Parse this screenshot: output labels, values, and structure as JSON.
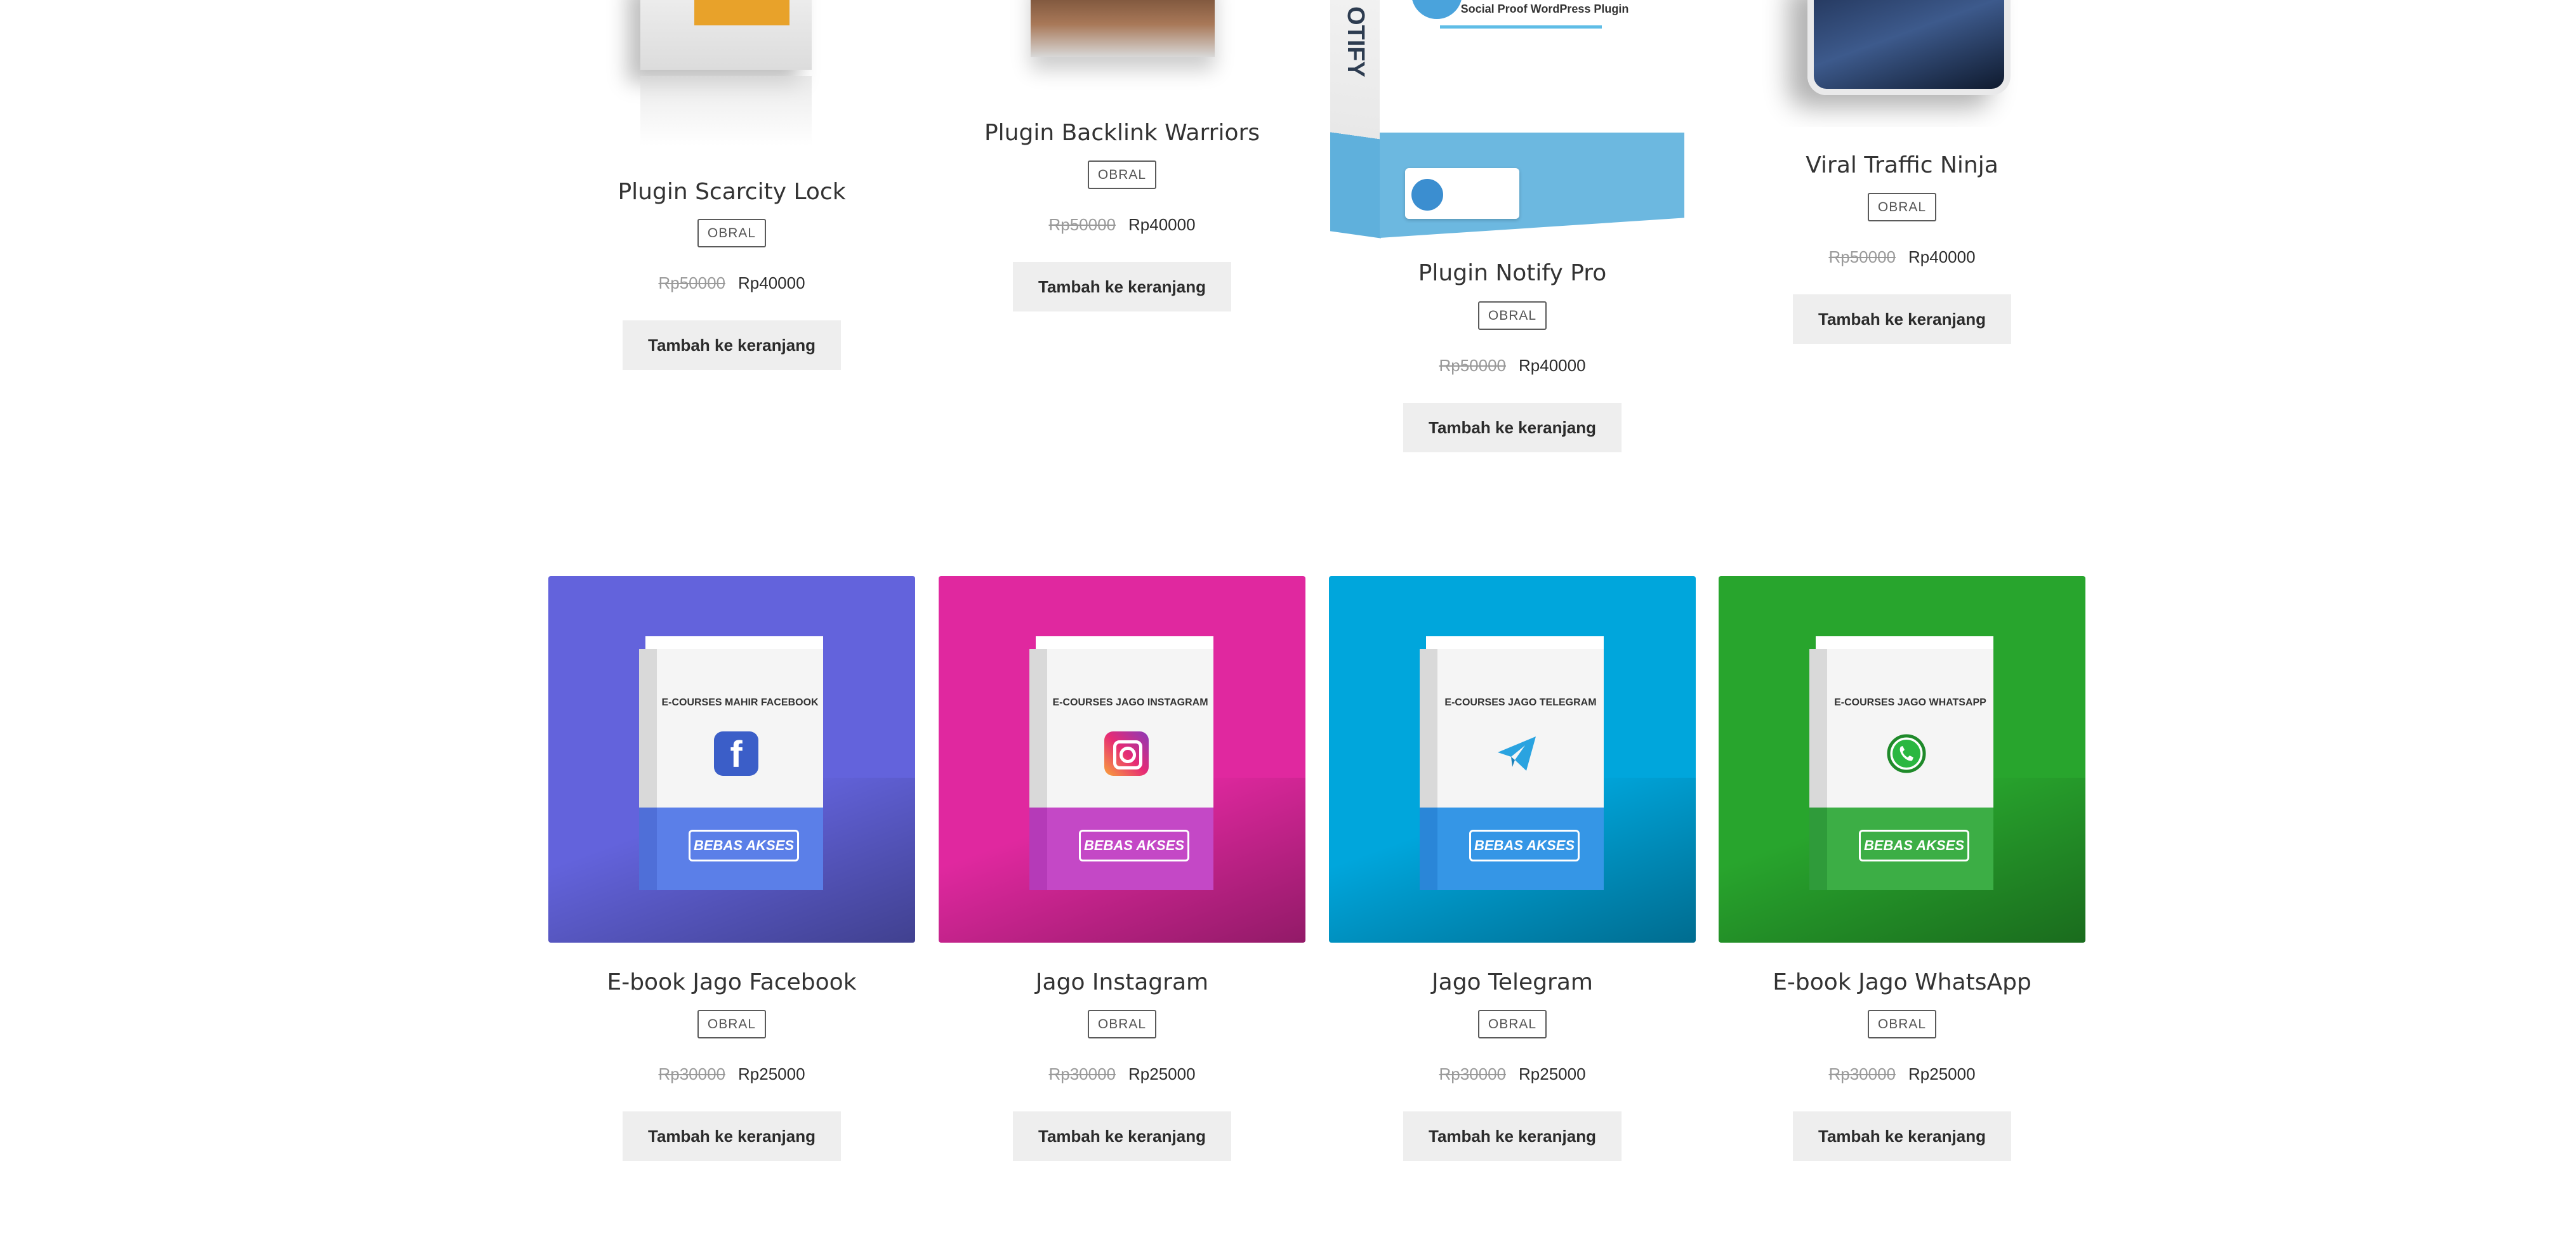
{
  "colors": {
    "page_bg": "#ffffff",
    "button_bg": "#eeeeee",
    "facebook_bg": "#6060d8",
    "instagram_bg": "#e0289f",
    "telegram_bg": "#00a6dc",
    "whatsapp_bg": "#28a52d"
  },
  "products_top": [
    {
      "title": "Plugin Scarcity Lock",
      "badge": "OBRAL",
      "price_old": "Rp50000",
      "price_new": "Rp40000",
      "button": "Tambah ke keranjang"
    },
    {
      "title": "Plugin Backlink Warriors",
      "badge": "OBRAL",
      "price_old": "Rp50000",
      "price_new": "Rp40000",
      "button": "Tambah ke keranjang"
    },
    {
      "title": "Plugin Notify Pro",
      "badge": "OBRAL",
      "price_old": "Rp50000",
      "price_new": "Rp40000",
      "button": "Tambah ke keranjang",
      "box_text": "Social Proof WordPress Plugin",
      "box_side_text": "OTIFY"
    },
    {
      "title": "Viral Traffic Ninja",
      "badge": "OBRAL",
      "price_old": "Rp50000",
      "price_new": "Rp40000",
      "button": "Tambah ke keranjang"
    }
  ],
  "products_bottom": [
    {
      "title": "E-book Jago Facebook",
      "badge": "OBRAL",
      "price_old": "Rp30000",
      "price_new": "Rp25000",
      "button": "Tambah ke keranjang",
      "box_title": "E-COURSES MAHIR FACEBOOK",
      "box_band": "BEBAS AKSES",
      "icon": "facebook-icon"
    },
    {
      "title": "Jago Instagram",
      "badge": "OBRAL",
      "price_old": "Rp30000",
      "price_new": "Rp25000",
      "button": "Tambah ke keranjang",
      "box_title": "E-COURSES JAGO INSTAGRAM",
      "box_band": "BEBAS AKSES",
      "icon": "instagram-icon"
    },
    {
      "title": "Jago Telegram",
      "badge": "OBRAL",
      "price_old": "Rp30000",
      "price_new": "Rp25000",
      "button": "Tambah ke keranjang",
      "box_title": "E-COURSES JAGO TELEGRAM",
      "box_band": "BEBAS AKSES",
      "icon": "telegram-icon"
    },
    {
      "title": "E-book Jago WhatsApp",
      "badge": "OBRAL",
      "price_old": "Rp30000",
      "price_new": "Rp25000",
      "button": "Tambah ke keranjang",
      "box_title": "E-COURSES JAGO WHATSAPP",
      "box_band": "BEBAS AKSES",
      "icon": "whatsapp-icon"
    }
  ]
}
